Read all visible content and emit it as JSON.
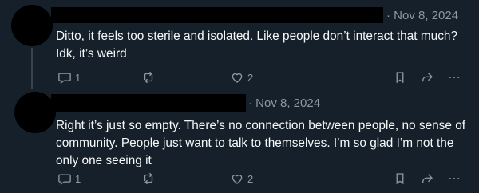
{
  "posts": [
    {
      "timestamp": "· Nov 8, 2024",
      "text": "Ditto, it feels too sterile and isolated. Like people don’t interact that much? Idk, it’s weird",
      "reply_count": "1",
      "like_count": "2"
    },
    {
      "timestamp": "· Nov 8, 2024",
      "text": "Right it’s just so empty. There’s no connection between people, no sense of community. People just want to talk to themselves. I’m so glad I’m not the only one seeing it",
      "reply_count": "1",
      "like_count": "2"
    }
  ],
  "icons": {
    "reply": "reply-icon",
    "repost": "repost-icon",
    "like": "heart-icon",
    "bookmark": "bookmark-icon",
    "share": "share-icon",
    "more": "more-icon"
  },
  "colors": {
    "background": "#15202b",
    "text": "#f7f9f9",
    "muted": "#8b98a5",
    "redaction": "#000000"
  }
}
